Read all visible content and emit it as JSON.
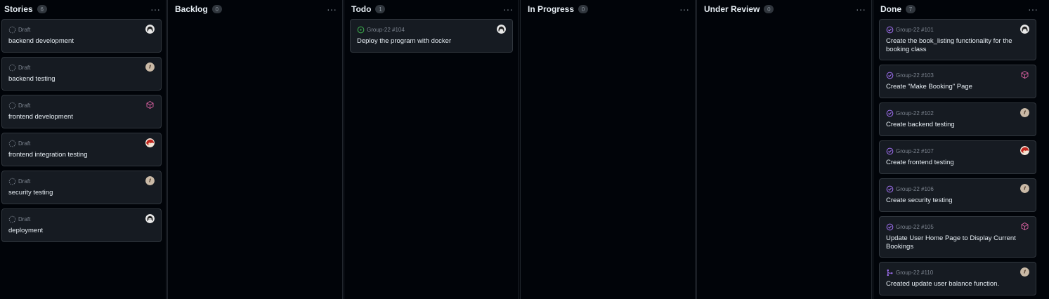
{
  "columns": [
    {
      "title": "Stories",
      "count": "6",
      "cards": [
        {
          "meta": "Draft",
          "title": "backend development",
          "status": "draft",
          "avatar": "robot-avatar"
        },
        {
          "meta": "Draft",
          "title": "backend testing",
          "status": "draft",
          "avatar": "tan-avatar"
        },
        {
          "meta": "Draft",
          "title": "frontend development",
          "status": "draft",
          "avatar": "pink-cube-avatar"
        },
        {
          "meta": "Draft",
          "title": "frontend integration testing",
          "status": "draft",
          "avatar": "red-avatar"
        },
        {
          "meta": "Draft",
          "title": "security testing",
          "status": "draft",
          "avatar": "tan-avatar"
        },
        {
          "meta": "Draft",
          "title": "deployment",
          "status": "draft",
          "avatar": "robot-avatar"
        }
      ]
    },
    {
      "title": "Backlog",
      "count": "0",
      "cards": []
    },
    {
      "title": "Todo",
      "count": "1",
      "cards": [
        {
          "meta": "Group-22 #104",
          "title": "Deploy the program with docker",
          "status": "open",
          "avatar": "robot-avatar"
        }
      ]
    },
    {
      "title": "In Progress",
      "count": "0",
      "cards": []
    },
    {
      "title": "Under Review",
      "count": "0",
      "cards": []
    },
    {
      "title": "Done",
      "count": "7",
      "cards": [
        {
          "meta": "Group-22 #101",
          "title": "Create the book_listing functionality for the booking class",
          "status": "done",
          "avatar": "robot-avatar"
        },
        {
          "meta": "Group-22 #103",
          "title": "Create \"Make Booking\" Page",
          "status": "done",
          "avatar": "pink-cube-avatar"
        },
        {
          "meta": "Group-22 #102",
          "title": "Create backend testing",
          "status": "done",
          "avatar": "tan-avatar"
        },
        {
          "meta": "Group-22 #107",
          "title": "Create frontend testing",
          "status": "done",
          "avatar": "red-avatar"
        },
        {
          "meta": "Group-22 #106",
          "title": "Create security testing",
          "status": "done",
          "avatar": "tan-avatar"
        },
        {
          "meta": "Group-22 #105",
          "title": "Update User Home Page to Display Current Bookings",
          "status": "done",
          "avatar": "pink-cube-avatar"
        },
        {
          "meta": "Group-22 #110",
          "title": "Created update user balance function.",
          "status": "merged",
          "avatar": "tan-avatar"
        }
      ]
    }
  ],
  "menu_glyph": "···",
  "colors": {
    "background": "#010409",
    "card": "#161b22",
    "border": "#30363d",
    "open": "#3fb950",
    "done": "#a371f7",
    "draft": "#7d8590"
  }
}
